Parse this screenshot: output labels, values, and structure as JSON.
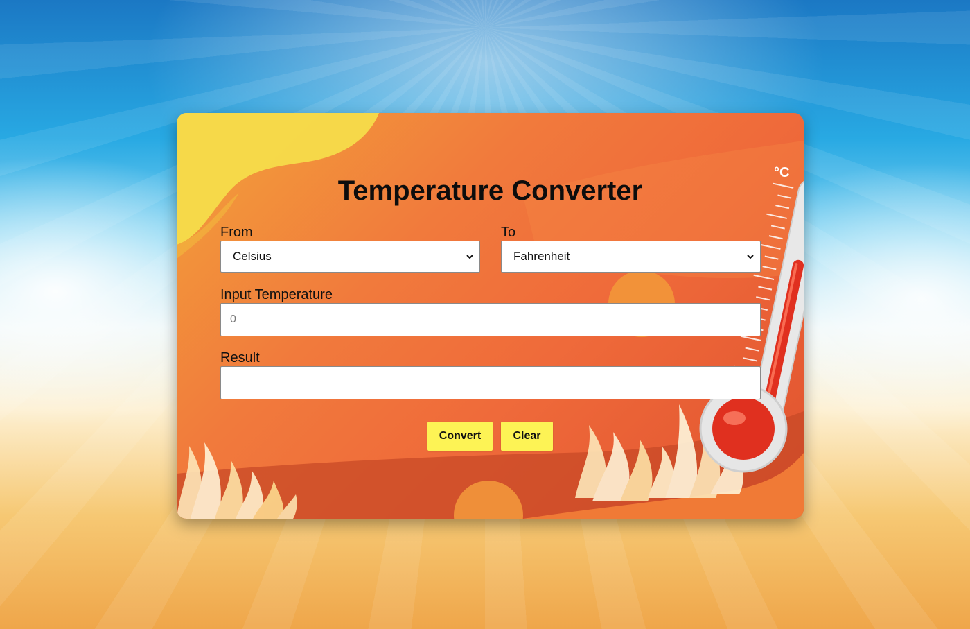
{
  "app": {
    "title": "Temperature Converter"
  },
  "form": {
    "from_label": "From",
    "from_value": "Celsius",
    "to_label": "To",
    "to_value": "Fahrenheit",
    "input_label": "Input Temperature",
    "input_value": "",
    "input_placeholder": "0",
    "result_label": "Result",
    "result_value": ""
  },
  "buttons": {
    "convert_label": "Convert",
    "clear_label": "Clear"
  },
  "thermometer": {
    "unit_label": "°C"
  },
  "icons": {
    "select_arrow": "chevron-down-icon",
    "thermometer": "thermometer-icon",
    "flames": "flame-icon"
  },
  "colors": {
    "card_orange": "#ef6a3a",
    "card_yellow": "#f6dc4a",
    "button_yellow": "#fdf355",
    "mercury_red": "#e0301f"
  }
}
